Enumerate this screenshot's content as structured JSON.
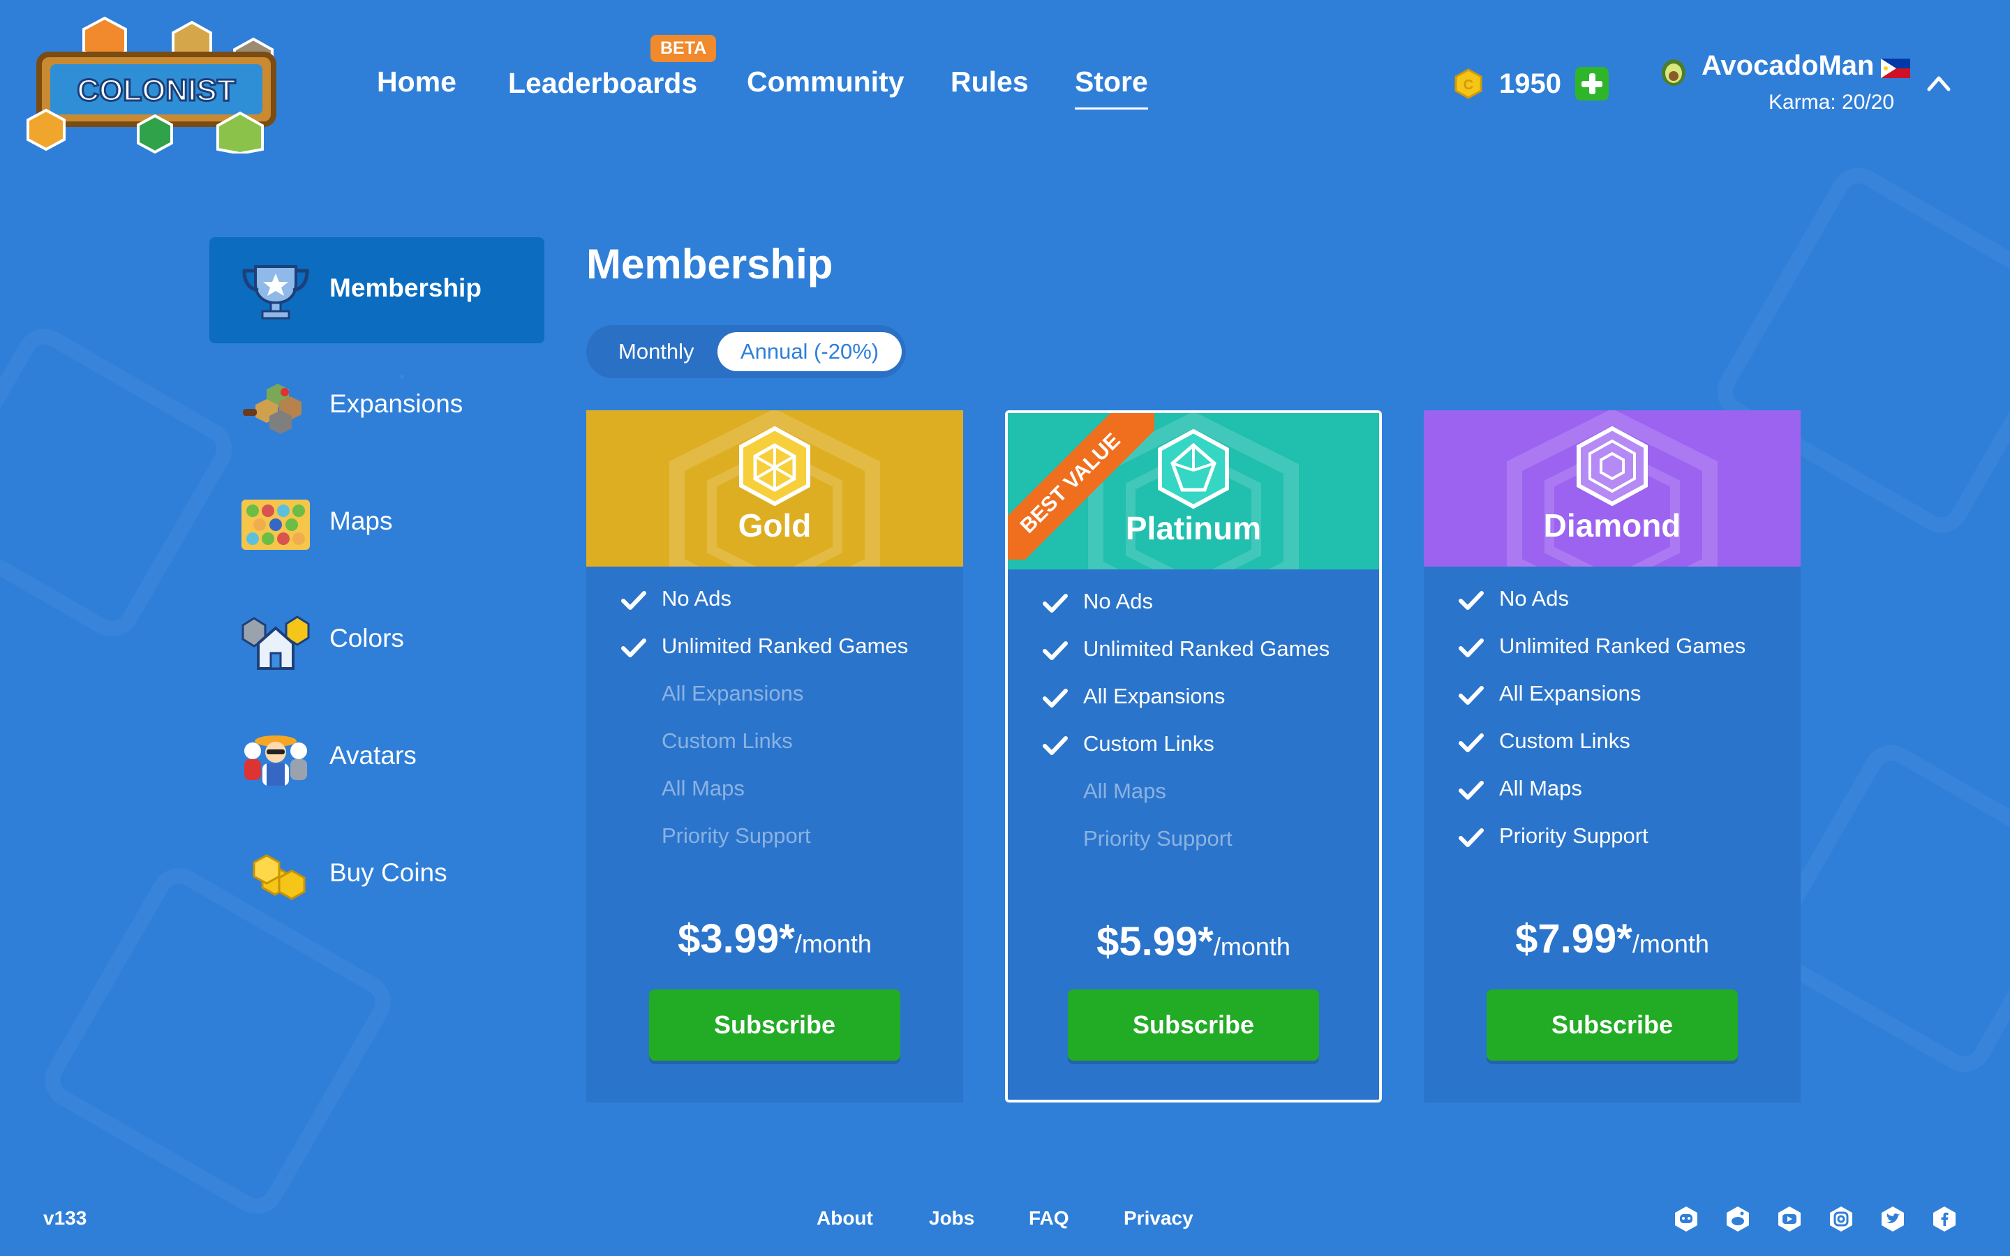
{
  "header": {
    "logo_text": "COLONIST",
    "nav": [
      "Home",
      "Leaderboards",
      "Community",
      "Rules",
      "Store"
    ],
    "beta_badge": "BETA",
    "coins": "1950",
    "user": {
      "name": "AvocadoMan",
      "karma": "Karma: 20/20"
    }
  },
  "sidebar": {
    "items": [
      {
        "label": "Membership",
        "icon": "trophy-icon"
      },
      {
        "label": "Expansions",
        "icon": "expansions-icon"
      },
      {
        "label": "Maps",
        "icon": "maps-icon"
      },
      {
        "label": "Colors",
        "icon": "colors-icon"
      },
      {
        "label": "Avatars",
        "icon": "avatars-icon"
      },
      {
        "label": "Buy Coins",
        "icon": "coins-icon"
      }
    ]
  },
  "main": {
    "title": "Membership",
    "billing_toggle": {
      "monthly": "Monthly",
      "annual": "Annual (-20%)",
      "selected": "annual"
    },
    "plans": [
      {
        "name": "Gold",
        "color": "#deae22",
        "price": "$3.99*",
        "period": "/month",
        "button": "Subscribe",
        "features": [
          {
            "label": "No Ads",
            "included": true
          },
          {
            "label": "Unlimited Ranked Games",
            "included": true
          },
          {
            "label": "All Expansions",
            "included": false
          },
          {
            "label": "Custom Links",
            "included": false
          },
          {
            "label": "All Maps",
            "included": false
          },
          {
            "label": "Priority Support",
            "included": false
          }
        ]
      },
      {
        "name": "Platinum",
        "color": "#20bfae",
        "price": "$5.99*",
        "period": "/month",
        "button": "Subscribe",
        "ribbon": "BEST VALUE",
        "features": [
          {
            "label": "No Ads",
            "included": true
          },
          {
            "label": "Unlimited Ranked Games",
            "included": true
          },
          {
            "label": "All Expansions",
            "included": true
          },
          {
            "label": "Custom Links",
            "included": true
          },
          {
            "label": "All Maps",
            "included": false
          },
          {
            "label": "Priority Support",
            "included": false
          }
        ]
      },
      {
        "name": "Diamond",
        "color": "#9c63f0",
        "price": "$7.99*",
        "period": "/month",
        "button": "Subscribe",
        "features": [
          {
            "label": "No Ads",
            "included": true
          },
          {
            "label": "Unlimited Ranked Games",
            "included": true
          },
          {
            "label": "All Expansions",
            "included": true
          },
          {
            "label": "Custom Links",
            "included": true
          },
          {
            "label": "All Maps",
            "included": true
          },
          {
            "label": "Priority Support",
            "included": true
          }
        ]
      }
    ]
  },
  "footer": {
    "version": "v133",
    "links": [
      "About",
      "Jobs",
      "FAQ",
      "Privacy"
    ],
    "social": [
      "discord-icon",
      "reddit-icon",
      "youtube-icon",
      "instagram-icon",
      "twitter-icon",
      "facebook-icon"
    ]
  }
}
